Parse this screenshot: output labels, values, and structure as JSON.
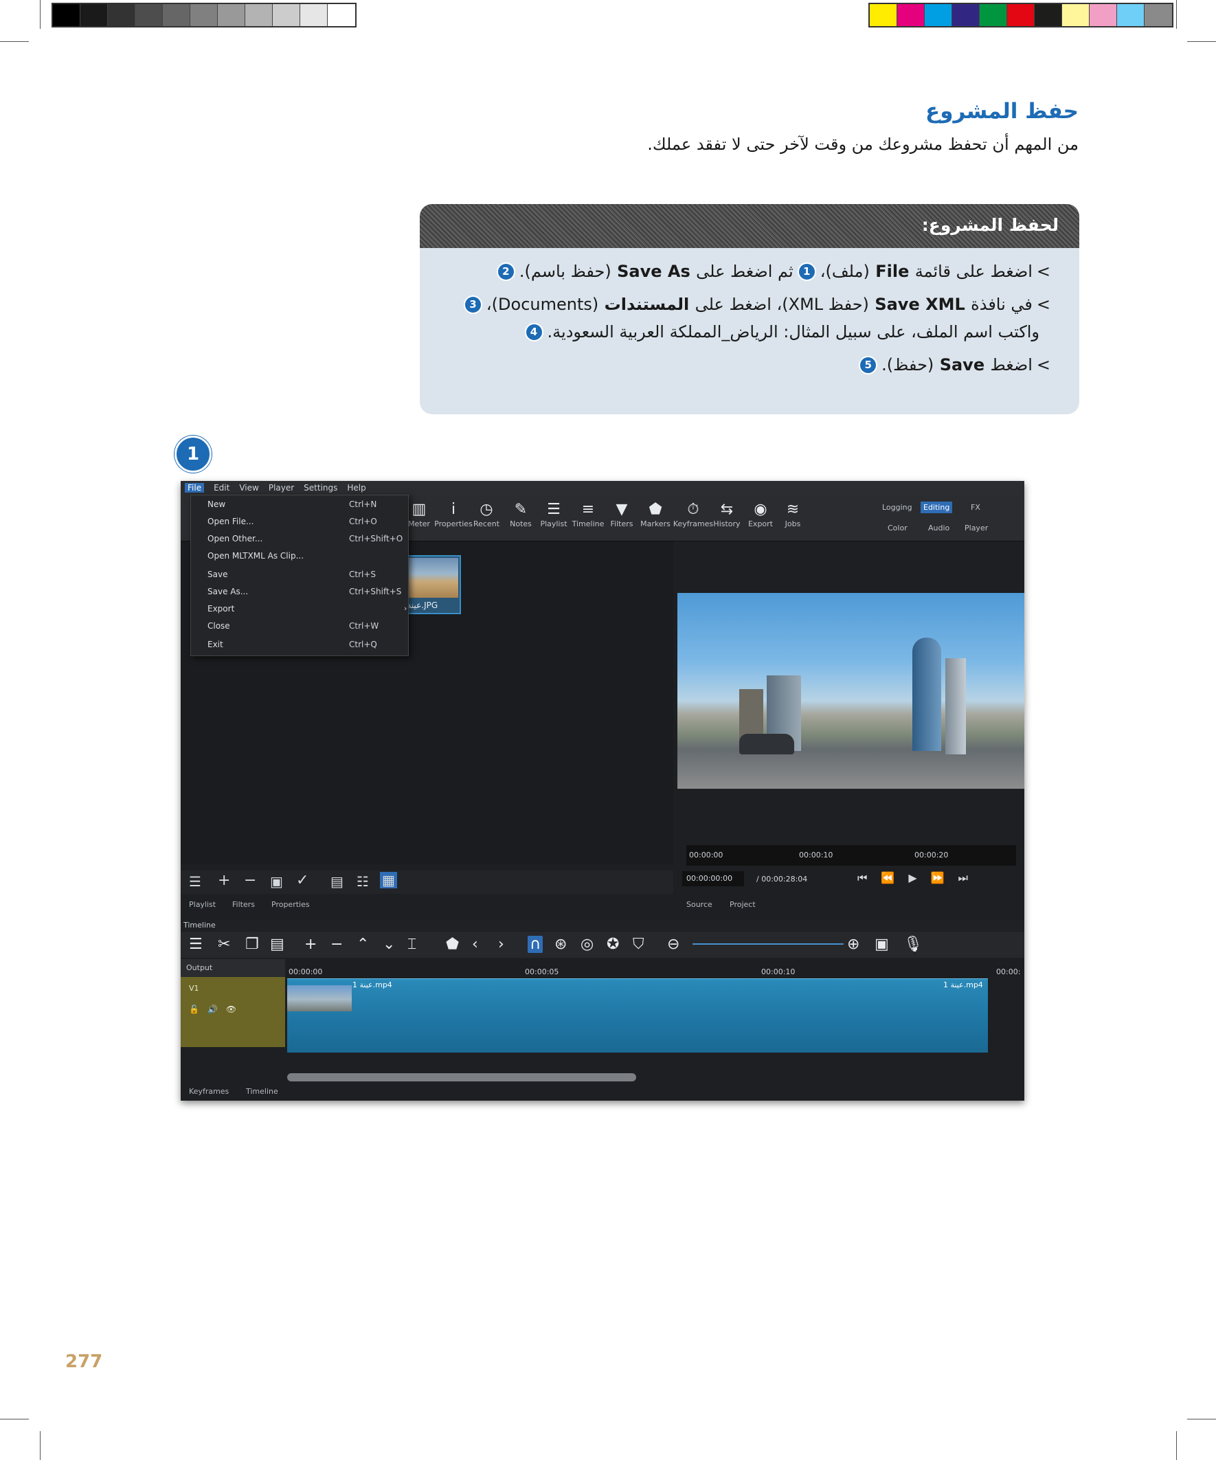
{
  "heading": {
    "title": "حفظ المشروع",
    "intro": "من المهم أن تحفظ مشروعك من وقت لآخر حتى لا تفقد عملك."
  },
  "instructions": {
    "header": "لحفظ المشروع:",
    "steps": [
      {
        "marker": ">",
        "pre": "اضغط على قائمة",
        "en1": "File",
        "mid1": "(ملف)،",
        "badge1": "1",
        "mid2": "ثم اضغط على",
        "en2": "Save As",
        "post": "(حفظ باسم).",
        "badge2": "2"
      },
      {
        "marker": ">",
        "pre": "في نافذة",
        "en1": "Save XML",
        "mid1": "(حفظ XML)، اضغط على",
        "ar_bold": "المستندات",
        "post": "(Documents)،",
        "badge": "3"
      },
      {
        "text": "واكتب اسم الملف، على سبيل المثال: الرياض_المملكة العربية السعودية.",
        "badge": "4"
      },
      {
        "marker": ">",
        "pre": "اضغط",
        "en1": "Save",
        "post": "(حفظ).",
        "badge": "5"
      }
    ]
  },
  "screenshot": {
    "menubar": [
      "File",
      "Edit",
      "View",
      "Player",
      "Settings",
      "Help"
    ],
    "file_menu": [
      {
        "label": "New",
        "shortcut": "Ctrl+N"
      },
      {
        "label": "Open File...",
        "shortcut": "Ctrl+O"
      },
      {
        "label": "Open Other...",
        "shortcut": "Ctrl+Shift+O"
      },
      {
        "label": "Open MLTXML As Clip...",
        "shortcut": ""
      },
      {
        "label": "Save",
        "shortcut": "Ctrl+S"
      },
      {
        "label": "Save As...",
        "shortcut": "Ctrl+Shift+S"
      },
      {
        "label": "Export",
        "shortcut": ""
      },
      {
        "label": "Close",
        "shortcut": "Ctrl+W"
      },
      {
        "label": "Exit",
        "shortcut": "Ctrl+Q"
      }
    ],
    "toolbar": [
      "Meter",
      "Properties",
      "Recent",
      "Notes",
      "Playlist",
      "Timeline",
      "Filters",
      "Markers",
      "Keyframes",
      "History",
      "Export",
      "Jobs"
    ],
    "layouts_top": [
      "Logging",
      "Editing",
      "FX"
    ],
    "layouts_bottom": [
      "Color",
      "Audio",
      "Player"
    ],
    "playlist_clip": "عينة 1.JPG",
    "playlist_tabs": [
      "Playlist",
      "Filters",
      "Properties"
    ],
    "ruler_ticks": [
      "00:00:00",
      "00:00:10",
      "00:00:20"
    ],
    "timecode": "00:00:00:00",
    "duration": "/ 00:00:28:04",
    "source_tabs": [
      "Source",
      "Project"
    ],
    "timeline_label": "Timeline",
    "track_output": "Output",
    "track_v1": "V1",
    "tl_ticks": [
      "00:00:00",
      "00:00:05",
      "00:00:10",
      "00:00:"
    ],
    "clip_name": "عينة 1.mp4",
    "bottom_tabs": [
      "Keyframes",
      "Timeline"
    ]
  },
  "callouts": {
    "one": "1",
    "two": "2"
  },
  "page_number": "277",
  "colors": {
    "accent": "#1d6bb5",
    "box_bg": "#dbe4ec",
    "page_number": "#c9a167"
  }
}
